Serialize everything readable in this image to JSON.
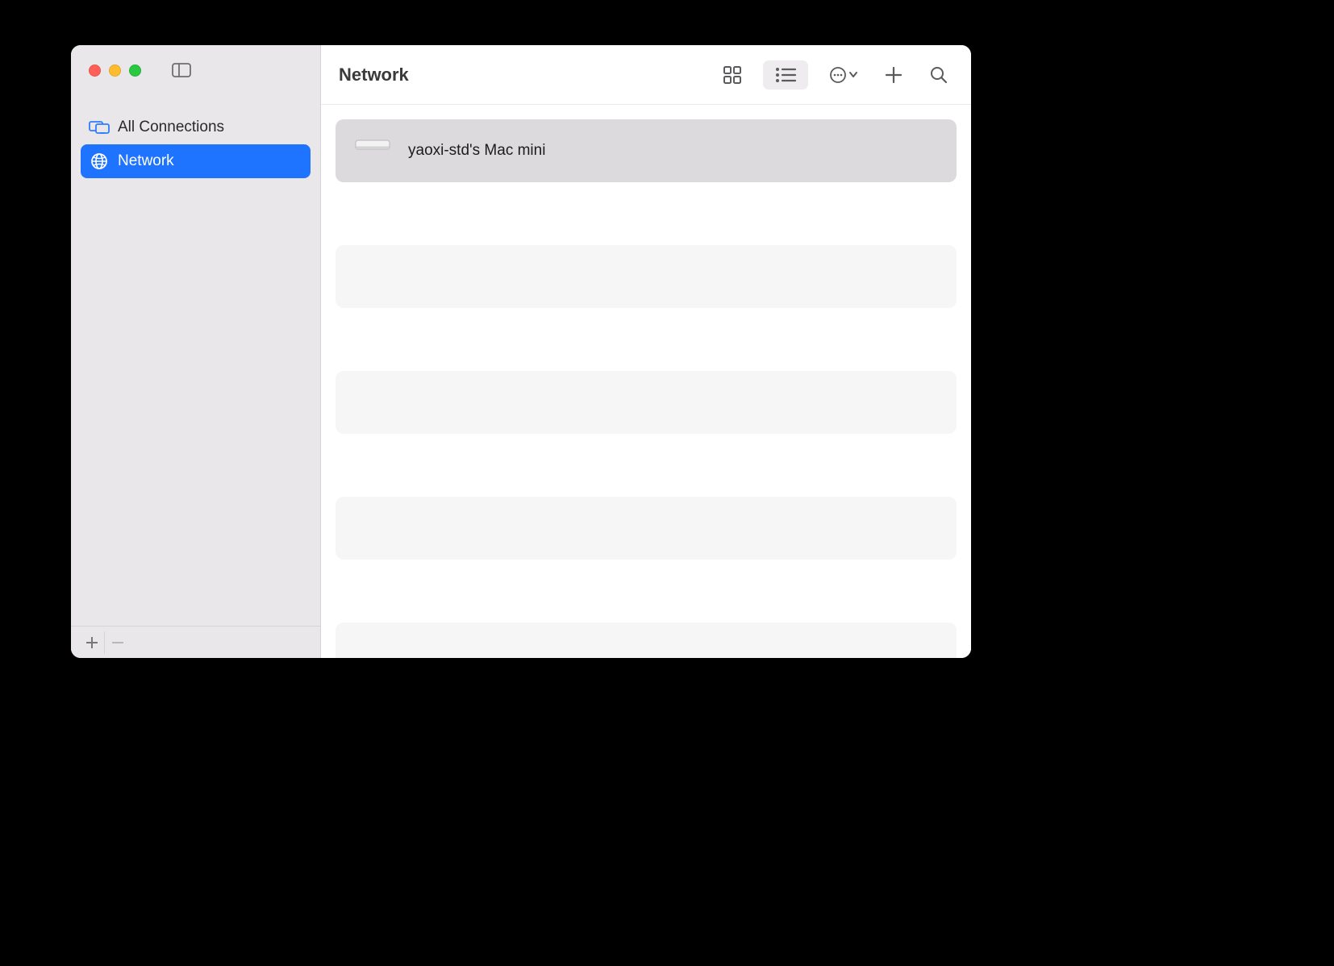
{
  "sidebar": {
    "items": [
      {
        "label": "All Connections",
        "icon": "displays",
        "selected": false
      },
      {
        "label": "Network",
        "icon": "globe",
        "selected": true
      }
    ]
  },
  "toolbar": {
    "title": "Network",
    "view_mode": "list"
  },
  "content": {
    "rows": [
      {
        "name": "yaoxi-std's Mac mini",
        "selected": true,
        "device": "mac-mini"
      }
    ],
    "empty_rows": 4
  }
}
